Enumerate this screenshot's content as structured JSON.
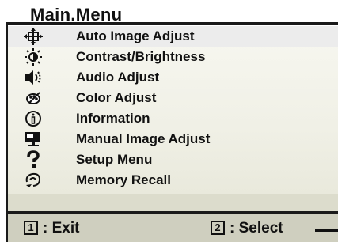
{
  "title": "Main.Menu",
  "menu": {
    "items": [
      {
        "label": "Auto Image Adjust",
        "icon": "auto-adjust-crosshair-icon"
      },
      {
        "label": "Contrast/Brightness",
        "icon": "sun-icon"
      },
      {
        "label": "Audio Adjust",
        "icon": "speaker-icon"
      },
      {
        "label": "Color Adjust",
        "icon": "palette-icon"
      },
      {
        "label": "Information",
        "icon": "info-icon"
      },
      {
        "label": "Manual Image Adjust",
        "icon": "monitor-icon"
      },
      {
        "label": "Setup Menu",
        "icon": "question-icon"
      },
      {
        "label": "Memory Recall",
        "icon": "memory-recall-icon"
      }
    ],
    "highlighted_index": 0
  },
  "footer": {
    "exit_key": "1",
    "exit_text": ": Exit",
    "select_key": "2",
    "select_text": ": Select"
  },
  "colors": {
    "menu_bg": "#f0f0e6",
    "footer_bg": "#cfcfbf",
    "band_bg": "#dcdccc",
    "text": "#111111"
  }
}
